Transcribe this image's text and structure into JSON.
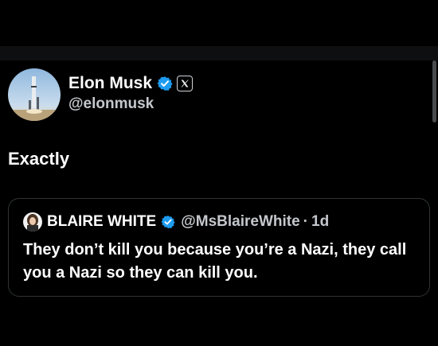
{
  "colors": {
    "background": "#000000",
    "text_primary": "#ffffff",
    "text_secondary": "#c4c8cd",
    "verified_blue": "#1d9bf0",
    "card_border": "#2f3336"
  },
  "tweet": {
    "author": {
      "display_name": "Elon Musk",
      "handle": "@elonmusk",
      "verified_icon": "verified-badge-icon",
      "affiliate_icon": "x-logo-icon"
    },
    "text": "Exactly"
  },
  "quote": {
    "author": {
      "display_name": "BLAIRE WHITE",
      "handle": "@MsBlaireWhite",
      "verified_icon": "verified-badge-icon"
    },
    "separator": "·",
    "time": "1d",
    "text": "They don’t kill you because you’re a Nazi, they call you a Nazi so they can kill you."
  }
}
